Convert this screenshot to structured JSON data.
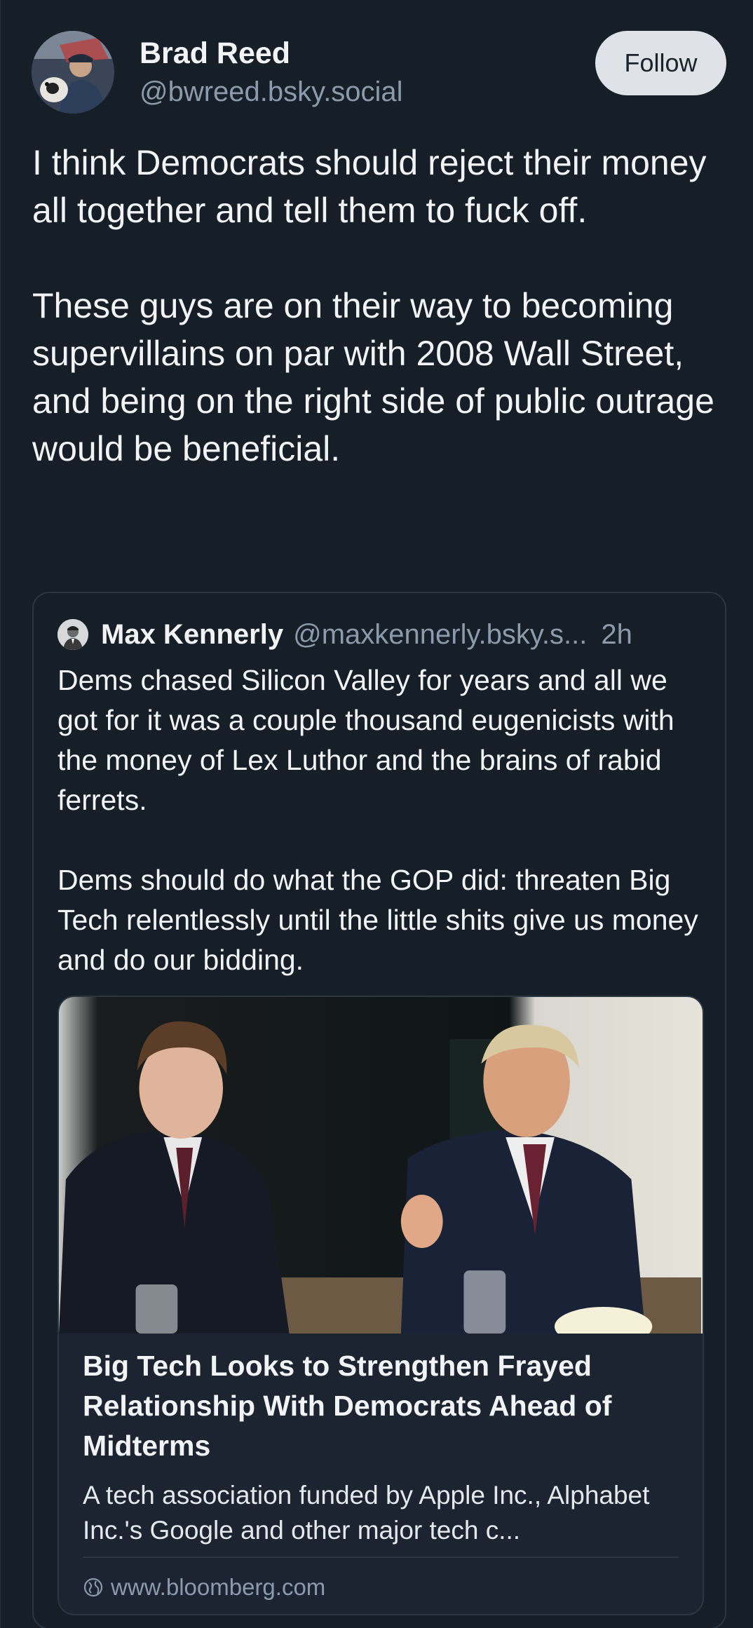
{
  "author": {
    "display_name": "Brad Reed",
    "handle": "@bwreed.bsky.social",
    "follow_label": "Follow"
  },
  "post": {
    "text": "I think Democrats should reject their money all together and tell them to fuck off.\n\nThese guys are on their way to becoming supervillains on par with 2008 Wall Street, and being on the right side of public outrage would be beneficial."
  },
  "quoted_post": {
    "display_name": "Max Kennerly",
    "handle": "@maxkennerly.bsky.s...",
    "time": "2h",
    "text": "Dems chased Silicon Valley for years and all we got for it was a couple thousand eugenicists with the money of Lex Luthor and the brains of rabid ferrets.\n\nDems should do what the GOP did: threaten Big Tech relentlessly until the little shits give us money and do our bidding.",
    "link_card": {
      "title": "Big Tech Looks to Strengthen Frayed Relationship With Democrats Ahead of Midterms",
      "description": "A tech association funded by Apple Inc., Alphabet Inc.'s Google and other major tech c...",
      "domain": "www.bloomberg.com"
    }
  },
  "colors": {
    "background": "#161e27",
    "border": "#2a3642",
    "muted_text": "#8c9aab",
    "follow_button_bg": "#dfe3e8"
  }
}
